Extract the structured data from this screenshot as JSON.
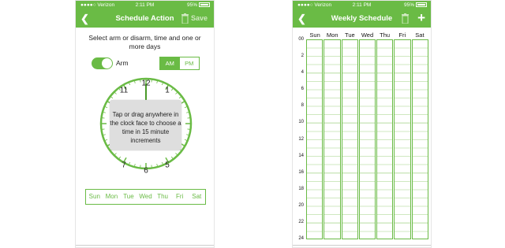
{
  "left": {
    "status": {
      "carrier": "●●●●○ Verizon",
      "time": "2:11 PM",
      "battery": "95%"
    },
    "nav": {
      "back_icon": "chevron-left-icon",
      "title": "Schedule Action",
      "trash_icon": "trash-icon",
      "save_label": "Save"
    },
    "instruction": "Select arm or disarm, time and one or more days",
    "toggle": {
      "label": "Arm",
      "state": "on"
    },
    "ampm": {
      "am": "AM",
      "pm": "PM",
      "selected": "AM"
    },
    "clock": {
      "numbers": [
        "12",
        "1",
        "5",
        "6",
        "7",
        "11"
      ],
      "hand_position": "12"
    },
    "overlay_text": "Tap or drag anywhere in the clock face to choose a time in 15 minute increments",
    "days": [
      "Sun",
      "Mon",
      "Tue",
      "Wed",
      "Thu",
      "Fri",
      "Sat"
    ],
    "accent": "#6abb45"
  },
  "right": {
    "status": {
      "carrier": "●●●●○ Verizon",
      "time": "2:11 PM",
      "battery": "95%"
    },
    "nav": {
      "back_icon": "chevron-left-icon",
      "title": "Weekly Schedule",
      "trash_icon": "trash-icon",
      "add_icon": "plus-icon"
    },
    "days": [
      "Sun",
      "Mon",
      "Tue",
      "Wed",
      "Thu",
      "Fri",
      "Sat"
    ],
    "hours": [
      "00",
      "2",
      "4",
      "6",
      "8",
      "10",
      "12",
      "14",
      "16",
      "18",
      "20",
      "22",
      "24"
    ]
  }
}
